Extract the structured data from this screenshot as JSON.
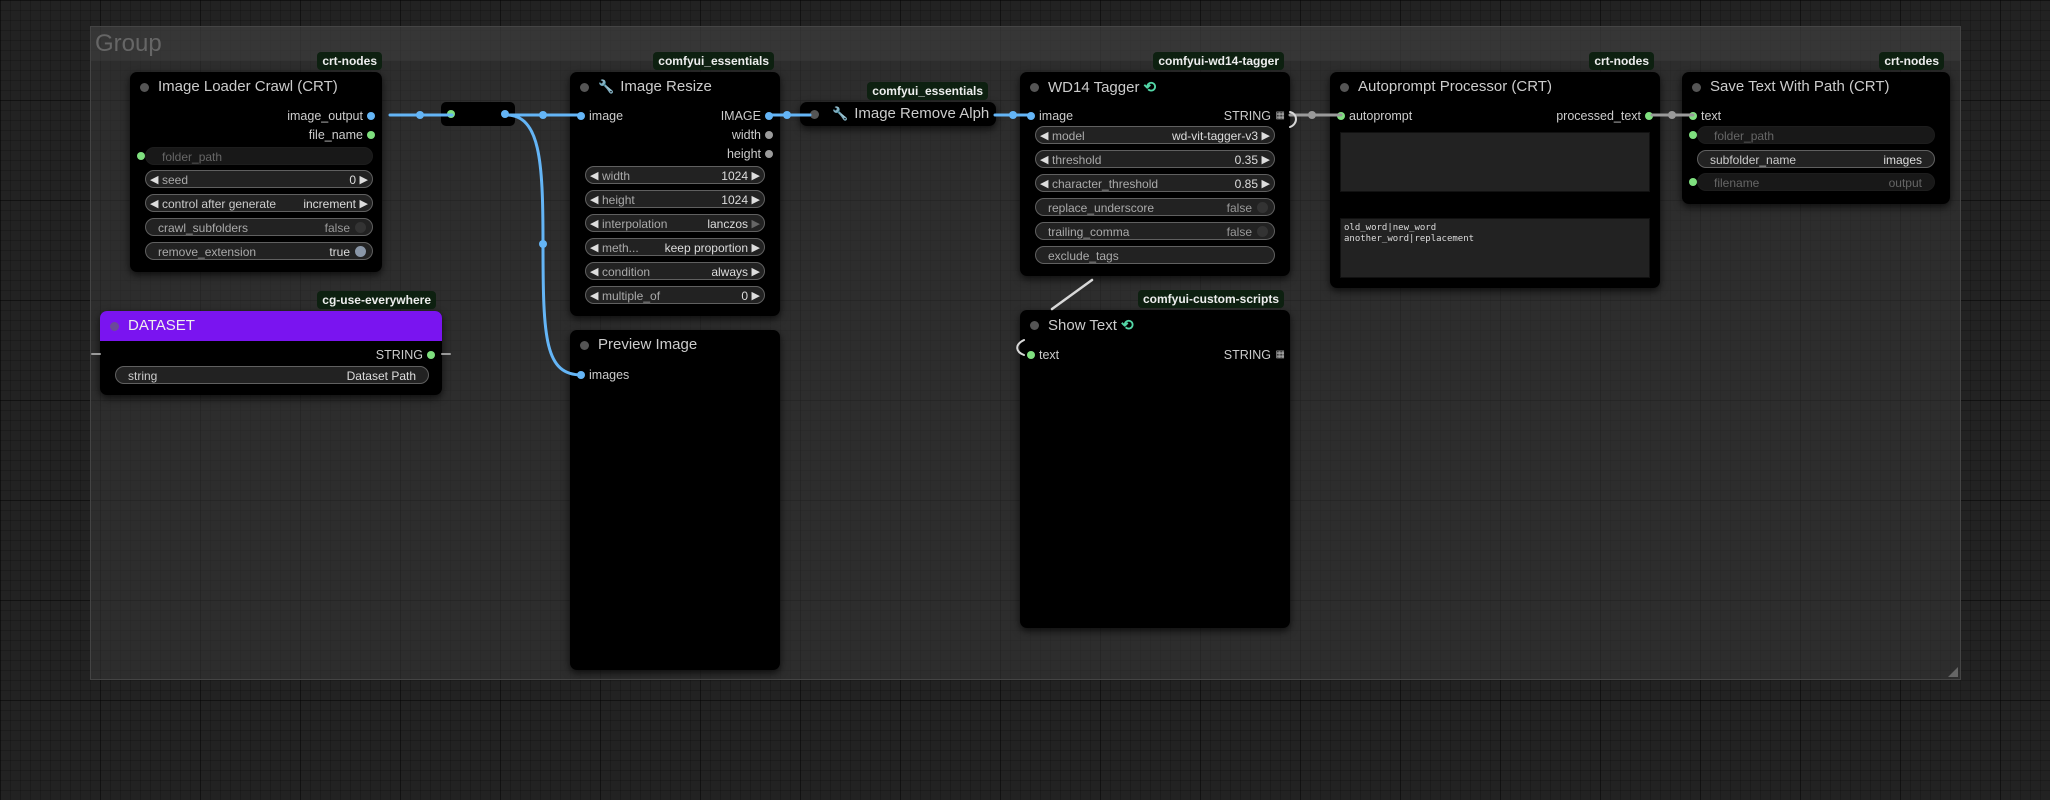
{
  "group": {
    "title": "Group"
  },
  "nodes": {
    "loader": {
      "badge": "crt-nodes",
      "title": "Image Loader Crawl (CRT)",
      "outputs": [
        "image_output",
        "file_name"
      ],
      "input_folder": "folder_path",
      "widgets": [
        {
          "label": "seed",
          "value": "0"
        },
        {
          "label": "control after generate",
          "value": "increment"
        },
        {
          "label": "crawl_subfolders",
          "value": "false"
        },
        {
          "label": "remove_extension",
          "value": "true"
        }
      ]
    },
    "dataset": {
      "badge": "cg-use-everywhere",
      "title": "DATASET",
      "output": "STRING",
      "widget": {
        "label": "string",
        "value": "Dataset Path"
      }
    },
    "resize": {
      "badge": "comfyui_essentials",
      "title": "Image Resize",
      "input": "image",
      "outputs": [
        "IMAGE",
        "width",
        "height"
      ],
      "widgets": [
        {
          "label": "width",
          "value": "1024"
        },
        {
          "label": "height",
          "value": "1024"
        },
        {
          "label": "interpolation",
          "value": "lanczos"
        },
        {
          "label": "meth...",
          "value": "keep proportion"
        },
        {
          "label": "condition",
          "value": "always"
        },
        {
          "label": "multiple_of",
          "value": "0"
        }
      ]
    },
    "preview": {
      "title": "Preview Image",
      "input": "images"
    },
    "remove_alpha": {
      "badge": "comfyui_essentials",
      "title": "Image Remove Alph"
    },
    "tagger": {
      "badge": "comfyui-wd14-tagger",
      "title": "WD14 Tagger",
      "input": "image",
      "output": "STRING",
      "widgets": [
        {
          "label": "model",
          "value": "wd-vit-tagger-v3"
        },
        {
          "label": "threshold",
          "value": "0.35"
        },
        {
          "label": "character_threshold",
          "value": "0.85"
        },
        {
          "label": "replace_underscore",
          "value": "false"
        },
        {
          "label": "trailing_comma",
          "value": "false"
        },
        {
          "label": "exclude_tags",
          "value": ""
        }
      ]
    },
    "show_text": {
      "badge": "comfyui-custom-scripts",
      "title": "Show Text",
      "input": "text",
      "output": "STRING"
    },
    "autoprompt": {
      "badge": "crt-nodes",
      "title": "Autoprompt Processor (CRT)",
      "input": "autoprompt",
      "output": "processed_text",
      "replacements_line1": "old_word|new_word",
      "replacements_line2": "another_word|replacement"
    },
    "save": {
      "badge": "crt-nodes",
      "title": "Save Text With Path (CRT)",
      "input": "text",
      "input_folder": "folder_path",
      "widgets": [
        {
          "label": "subfolder_name",
          "value": "images"
        },
        {
          "label": "filename",
          "value": "output"
        }
      ]
    }
  },
  "colors": {
    "image_wire": "#64b5f6",
    "string_wire": "#9a9a9a",
    "dataset_title": "#7a14f0"
  }
}
